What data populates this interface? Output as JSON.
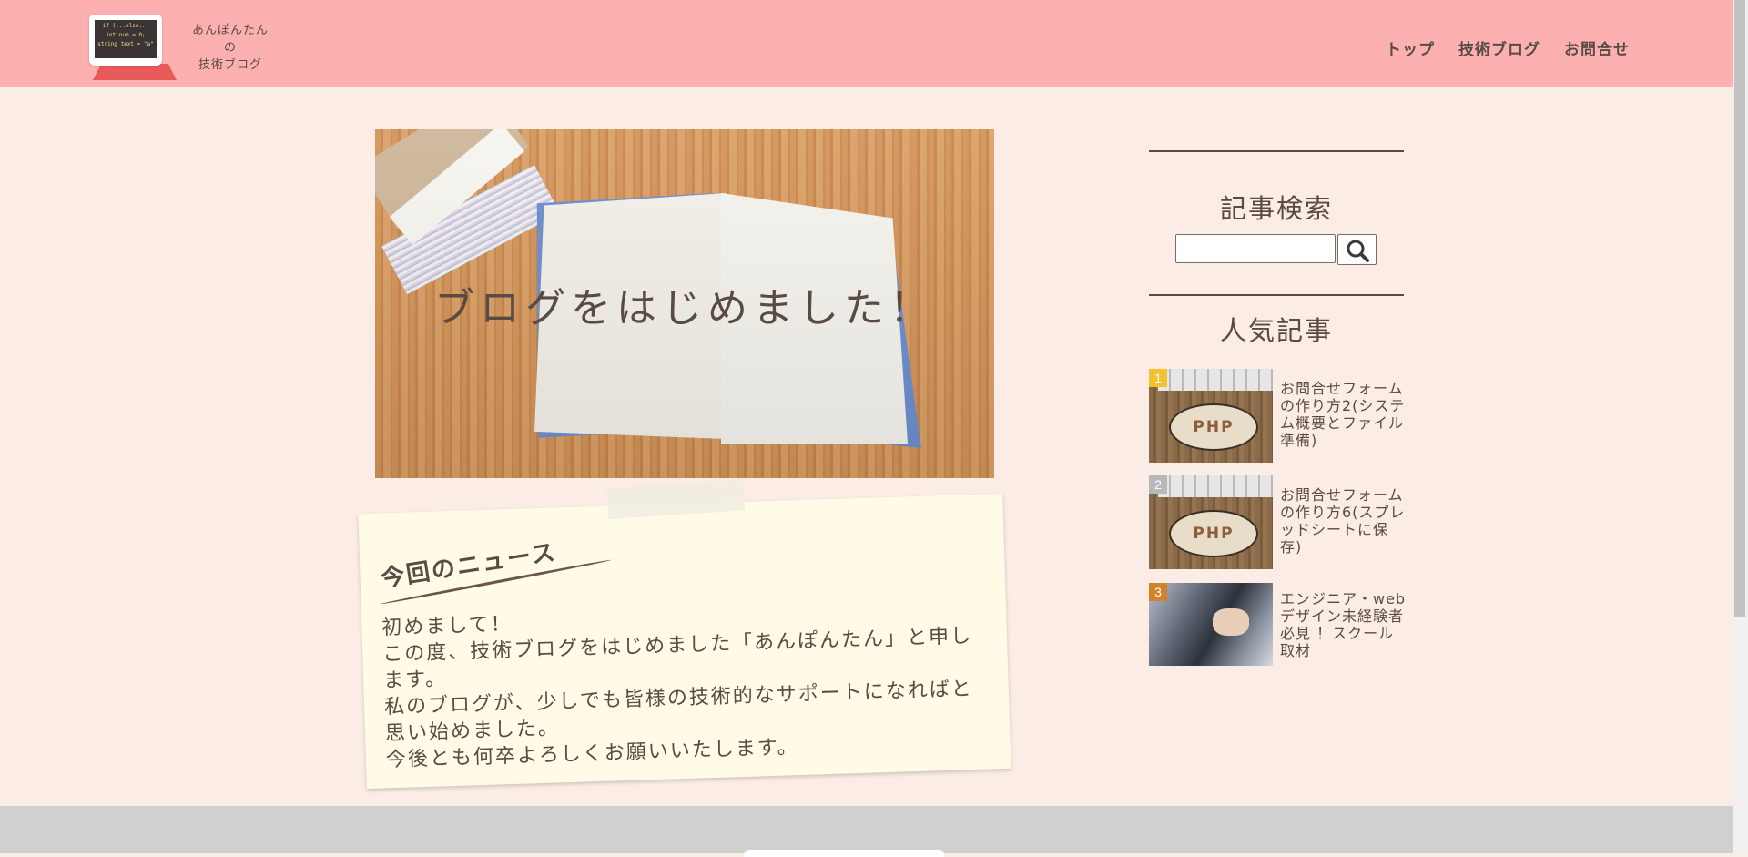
{
  "header": {
    "logo_screen_lines": [
      "if (...else...",
      "int num = 0;",
      "string text = \"a\""
    ],
    "site_name_lines": [
      "あんぽんたん",
      "の",
      "技術ブログ"
    ],
    "nav": [
      "トップ",
      "技術ブログ",
      "お問合せ"
    ]
  },
  "hero": {
    "title": "ブログをはじめました！"
  },
  "news": {
    "title": "今回のニュース",
    "lines": [
      "初めまして！",
      "この度、技術ブログをはじめました「あんぽんたん」と申します。",
      "私のブログが、少しでも皆様の技術的なサポートになればと思い始めました。",
      "今後とも何卒よろしくお願いいたします。"
    ]
  },
  "sidebar": {
    "search_heading": "記事検索",
    "search_value": "",
    "popular_heading": "人気記事",
    "popular": [
      {
        "rank": "1",
        "title": "お問合せフォームの作り方2(システム概要とファイル準備)",
        "thumb_text": "PHP",
        "rank_color": "#f2c230"
      },
      {
        "rank": "2",
        "title": "お問合せフォームの作り方6(スプレッドシートに保存)",
        "thumb_text": "PHP",
        "rank_color": "#b8b8b8"
      },
      {
        "rank": "3",
        "title": "エンジニア・webデザイン未経験者必見 ！スクール取材",
        "thumb_text": "",
        "rank_color": "#d2832a"
      }
    ]
  },
  "colors": {
    "header_bg": "#fcb0b0",
    "page_bg": "#fbece5",
    "note_bg": "#fffbe6",
    "text": "#5a4a44",
    "footer_bg": "#d0d0d0"
  }
}
